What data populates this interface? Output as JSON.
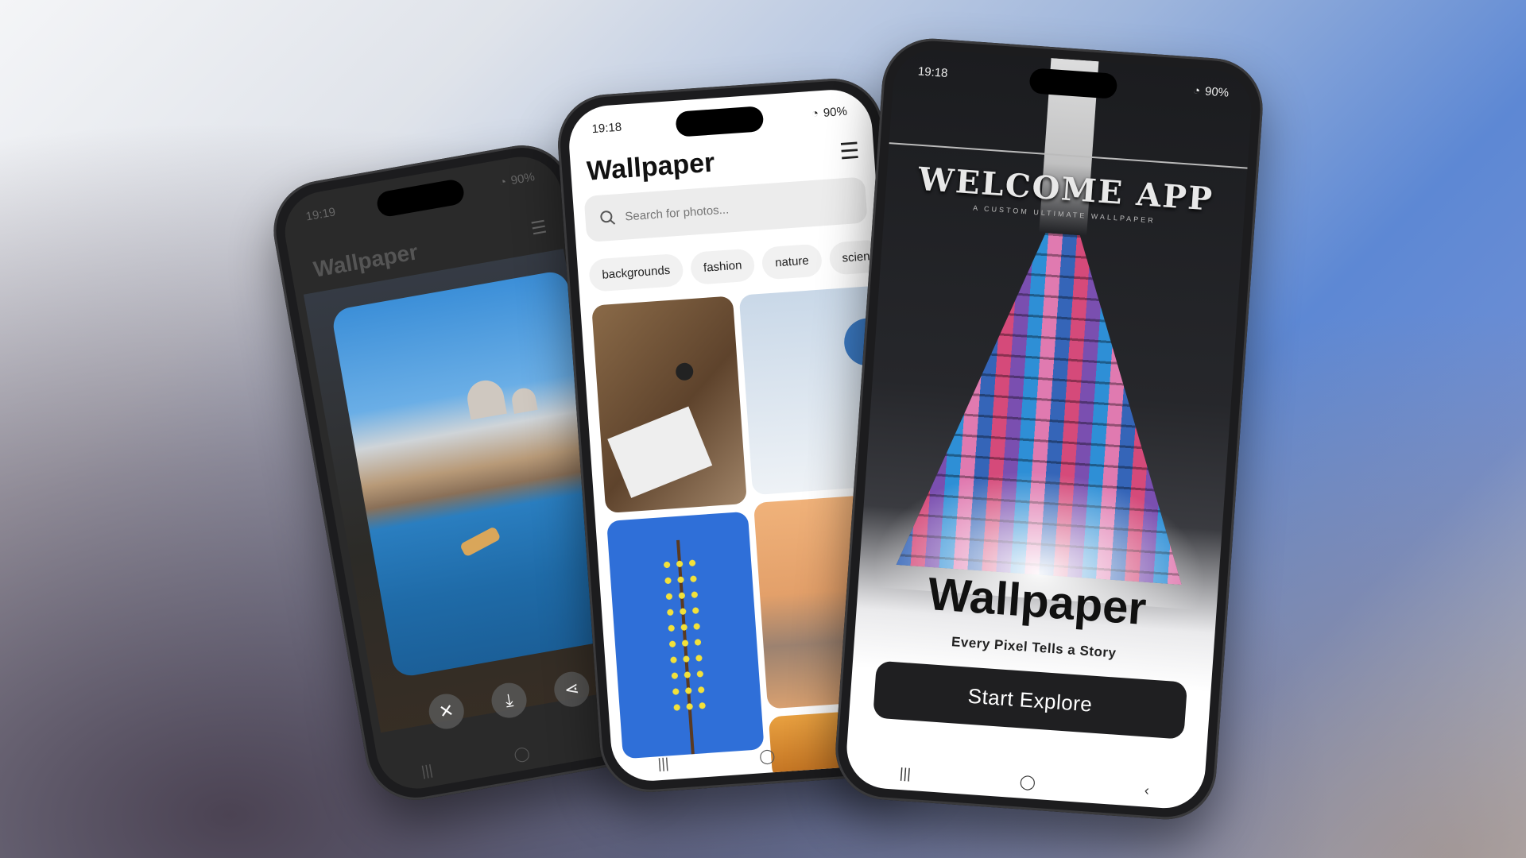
{
  "viewer_phone": {
    "status": {
      "time": "19:19",
      "battery": "90%"
    },
    "title": "Wallpaper",
    "actions": {
      "close": "✕",
      "download": "⤓",
      "share": "⋖"
    }
  },
  "gallery_phone": {
    "status": {
      "time": "19:18",
      "battery": "90%"
    },
    "title": "Wallpaper",
    "search": {
      "placeholder": "Search for photos..."
    },
    "chips": [
      "backgrounds",
      "fashion",
      "nature",
      "scien"
    ]
  },
  "welcome_phone": {
    "status": {
      "time": "19:18",
      "battery": "90%"
    },
    "heading": "WELCOME APP",
    "subheading": "A CUSTOM ULTIMATE WALLPAPER",
    "title": "Wallpaper",
    "tagline": "Every Pixel Tells a Story",
    "start_button": "Start Explore"
  },
  "navbar": {
    "recents": "|||",
    "home": "◯",
    "back": "‹"
  },
  "colors": {
    "button_dark": "#1f1f21",
    "accent_blue": "#5d88d4"
  }
}
